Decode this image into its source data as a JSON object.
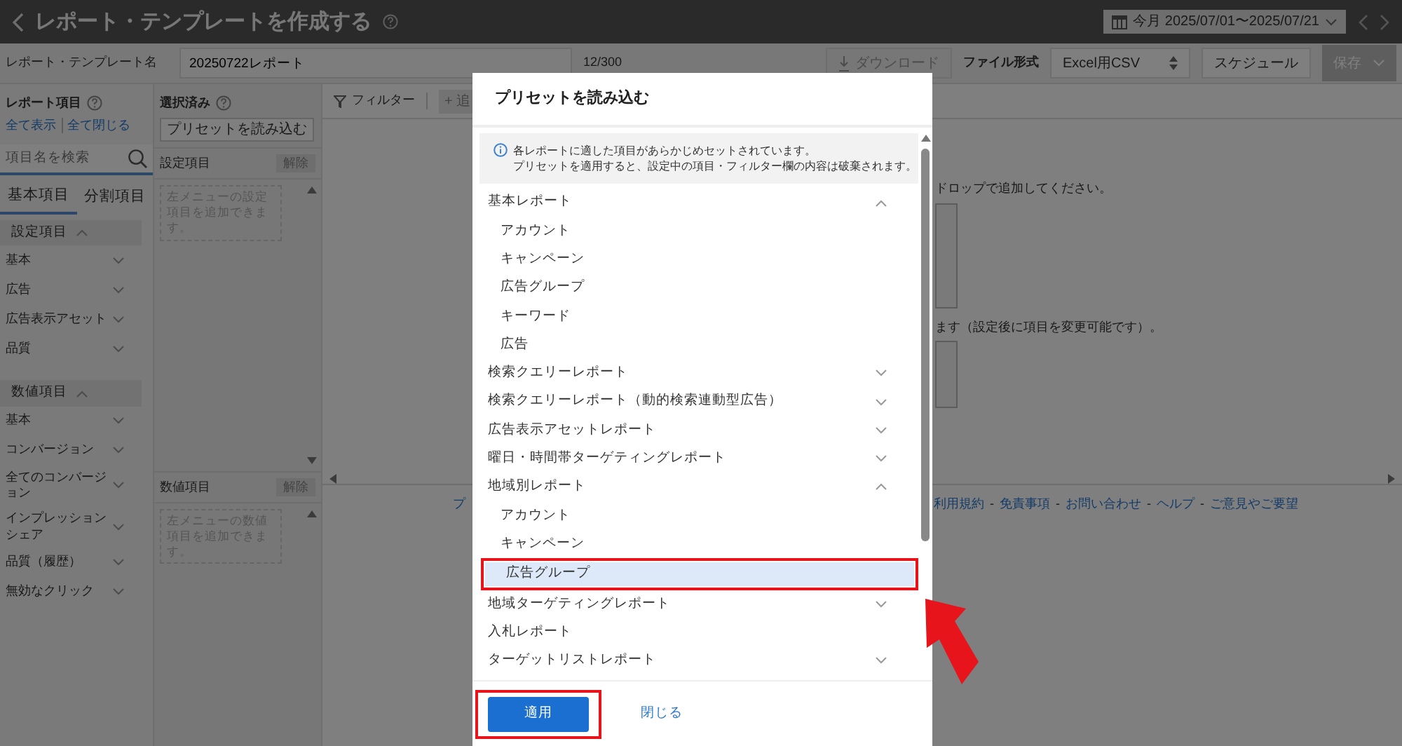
{
  "header": {
    "title": "レポート・テンプレートを作成する",
    "date_range": "今月 2025/07/01〜2025/07/21"
  },
  "toolbar": {
    "name_label": "レポート・テンプレート名",
    "name_value": "20250722レポート",
    "counter": "12/300",
    "download": {
      "label": "ダウンロード",
      "disabled": true
    },
    "format_label": "ファイル形式",
    "format_value": "Excel用CSV",
    "schedule": "スケジュール",
    "save": "保存"
  },
  "sidebar": {
    "title": "レポート項目",
    "links": [
      "全て表示",
      "全て閉じる"
    ],
    "search_placeholder": "項目名を検索",
    "tabs": [
      {
        "label": "基本項目",
        "selected": true
      },
      {
        "label": "分割項目",
        "selected": false
      }
    ],
    "sections": [
      {
        "label": "設定項目",
        "expanded": true,
        "items": [
          {
            "label": "基本",
            "expanded": false
          },
          {
            "label": "広告",
            "expanded": false
          },
          {
            "label": "広告表示アセット",
            "expanded": false
          },
          {
            "label": "品質",
            "expanded": false
          }
        ]
      },
      {
        "label": "数値項目",
        "expanded": true,
        "items": [
          {
            "label": "基本",
            "expanded": false
          },
          {
            "label": "コンバージョン",
            "expanded": false
          },
          {
            "label": "全てのコンバージョン",
            "expanded": false
          },
          {
            "label": "インプレッションシェア",
            "expanded": false
          },
          {
            "label": "品質（履歴）",
            "expanded": false
          },
          {
            "label": "無効なクリック",
            "expanded": false
          }
        ]
      }
    ]
  },
  "selected_panel": {
    "title": "選択済み",
    "preset_button": "プリセットを読み込む",
    "groups": [
      {
        "label": "設定項目",
        "clear": "解除",
        "hint": "左メニューの設定項目を追加できます。"
      },
      {
        "label": "数値項目",
        "clear": "解除",
        "hint": "左メニューの数値項目を追加できます。"
      }
    ]
  },
  "main": {
    "filter": "フィルター",
    "add": "+ 追",
    "notes": [
      "ドロップで追加してください。",
      "ます（設定後に項目を変更可能です）。"
    ],
    "footer_cut": "プ",
    "footer_links": [
      "利用規約",
      "免責事項",
      "お問い合わせ",
      "ヘルプ",
      "ご意見やご要望"
    ],
    "separator": "-"
  },
  "modal": {
    "title": "プリセットを読み込む",
    "info_lines": [
      "各レポートに適した項目があらかじめセットされています。",
      "プリセットを適用すると、設定中の項目・フィルター欄の内容は破棄されます。"
    ],
    "groups": [
      {
        "label": "基本レポート",
        "kind": "group",
        "expanded": true,
        "children": [
          {
            "label": "アカウント",
            "selected": false,
            "highlighted": false
          },
          {
            "label": "キャンペーン",
            "selected": false,
            "highlighted": false
          },
          {
            "label": "広告グループ",
            "selected": false,
            "highlighted": false
          },
          {
            "label": "キーワード",
            "selected": false,
            "highlighted": false
          },
          {
            "label": "広告",
            "selected": false,
            "highlighted": false
          }
        ]
      },
      {
        "label": "検索クエリーレポート",
        "kind": "group",
        "expanded": false
      },
      {
        "label": "検索クエリーレポート（動的検索連動型広告）",
        "kind": "group",
        "expanded": false
      },
      {
        "label": "広告表示アセットレポート",
        "kind": "group",
        "expanded": false
      },
      {
        "label": "曜日・時間帯ターゲティングレポート",
        "kind": "group",
        "expanded": false
      },
      {
        "label": "地域別レポート",
        "kind": "group",
        "expanded": true,
        "children": [
          {
            "label": "アカウント",
            "selected": false,
            "highlighted": false
          },
          {
            "label": "キャンペーン",
            "selected": false,
            "highlighted": false
          },
          {
            "label": "広告グループ",
            "selected": true,
            "highlighted": true
          }
        ]
      },
      {
        "label": "地域ターゲティングレポート",
        "kind": "group",
        "expanded": false
      },
      {
        "label": "入札レポート",
        "kind": "leaf"
      },
      {
        "label": "ターゲットリストレポート",
        "kind": "group",
        "expanded": false
      }
    ],
    "apply": {
      "label": "適用",
      "highlighted": true
    },
    "close": "閉じる",
    "pointer_arrow": true
  }
}
